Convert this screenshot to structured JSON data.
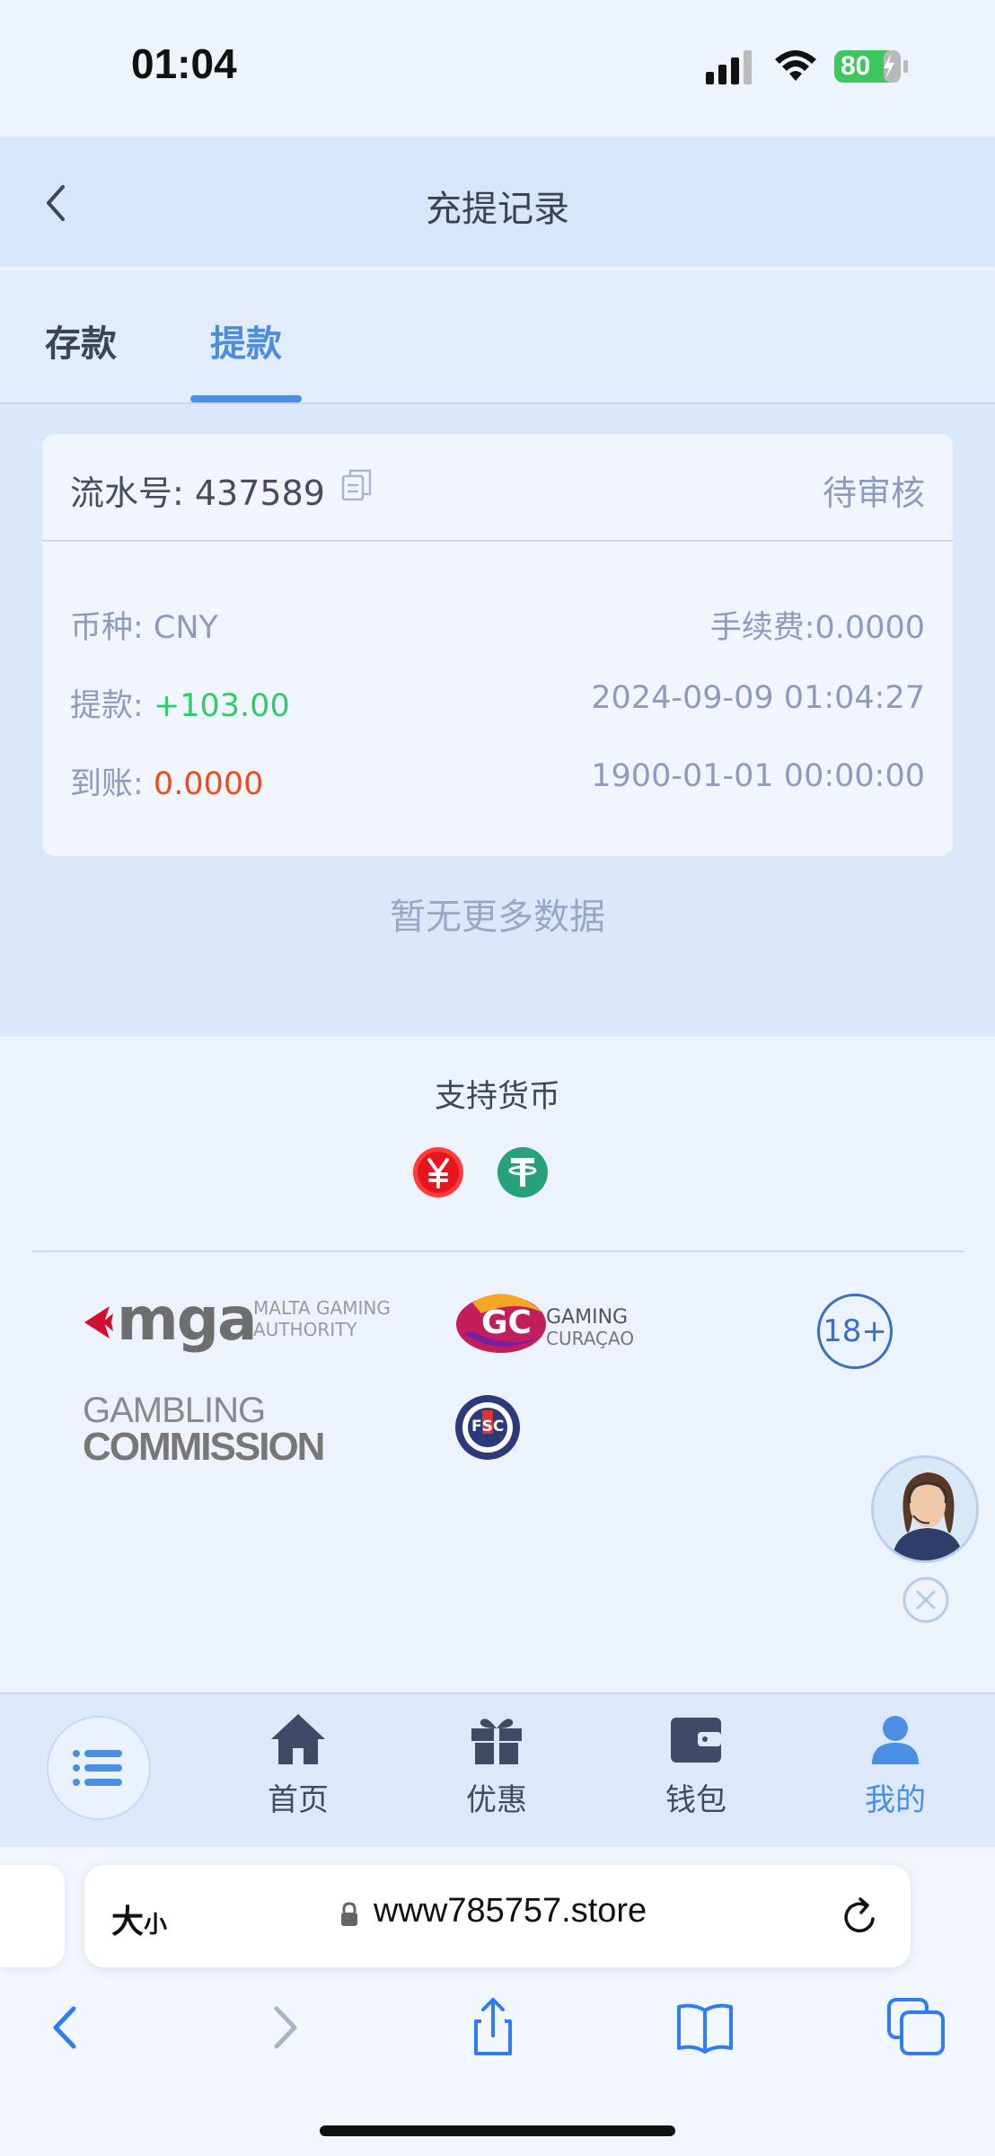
{
  "status_bar": {
    "time": "01:04",
    "battery": "80"
  },
  "header": {
    "title": "充提记录"
  },
  "tabs": [
    {
      "label": "存款",
      "active": false
    },
    {
      "label": "提款",
      "active": true
    }
  ],
  "record": {
    "serial_label": "流水号: 437589",
    "status": "待审核",
    "currency_label": "币种: CNY",
    "fee_label": "手续费:0.0000",
    "withdraw_label": "提款: ",
    "withdraw_amount": "+103.00",
    "withdraw_time": "2024-09-09 01:04:27",
    "received_label": "到账: ",
    "received_amount": "0.0000",
    "received_time": "1900-01-01 00:00:00"
  },
  "no_more": "暂无更多数据",
  "footer": {
    "support_title": "支持货币",
    "currency_icons": [
      "cny-icon",
      "usdt-icon"
    ],
    "logos": {
      "mga_main": "mga",
      "mga_sub1": "MALTA GAMING",
      "mga_sub2": "AUTHORITY",
      "gc_badge": "GC",
      "gc_text1": "GAMING",
      "gc_text2": "CURAÇAO",
      "age": "18+",
      "gamb1": "GAMBLING",
      "gamb2": "COMMISSION",
      "fsc": "FSC"
    }
  },
  "bottom_nav": [
    {
      "label": "首页",
      "icon": "home-icon"
    },
    {
      "label": "优惠",
      "icon": "gift-icon"
    },
    {
      "label": "钱包",
      "icon": "wallet-icon"
    },
    {
      "label": "我的",
      "icon": "user-icon",
      "active": true
    }
  ],
  "browser": {
    "text_size_big": "大",
    "text_size_small": "小",
    "url": "www785757.store"
  },
  "colors": {
    "accent": "#4a8fe2",
    "green": "#2fcb6b",
    "red": "#f04a1a",
    "muted": "#8e9ac0"
  }
}
